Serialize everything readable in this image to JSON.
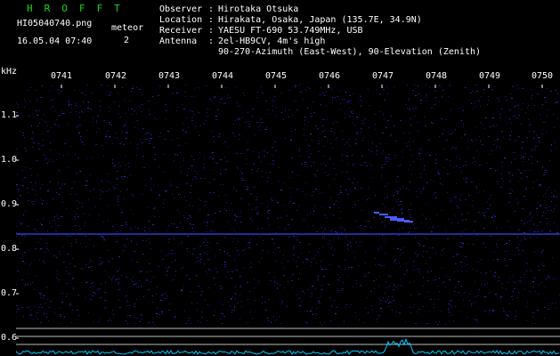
{
  "header": {
    "app_title": "H R O F F T",
    "file_name": "HI05040740.png",
    "timestamp": "16.05.04 07:40",
    "meteor_label": "meteor",
    "meteor_count": "2"
  },
  "info": [
    {
      "key": "Observer",
      "value": "Hirotaka Otsuka"
    },
    {
      "key": "Location",
      "value": "Hirakata, Osaka, Japan (135.7E, 34.9N)"
    },
    {
      "key": "Receiver",
      "value": "YAESU FT-690 53.749MHz, USB"
    },
    {
      "key": "Antenna",
      "value": "2el-HB9CV, 4m's high"
    },
    {
      "key": "",
      "value": "90-270-Azimuth (East-West), 90-Elevation (Zenith)"
    }
  ],
  "axis": {
    "y_unit": "kHz",
    "time_ticks": [
      "0741",
      "0742",
      "0743",
      "0744",
      "0745",
      "0746",
      "0747",
      "0748",
      "0749",
      "0750"
    ],
    "freq_ticks": [
      "1.1",
      "1.0",
      "0.9",
      "0.8",
      "0.7",
      "0.6"
    ]
  },
  "colors": {
    "title": "#19d419",
    "noise": "#1a1a8c",
    "echo": "#4a5cff",
    "trace": "#00c8ff"
  }
}
